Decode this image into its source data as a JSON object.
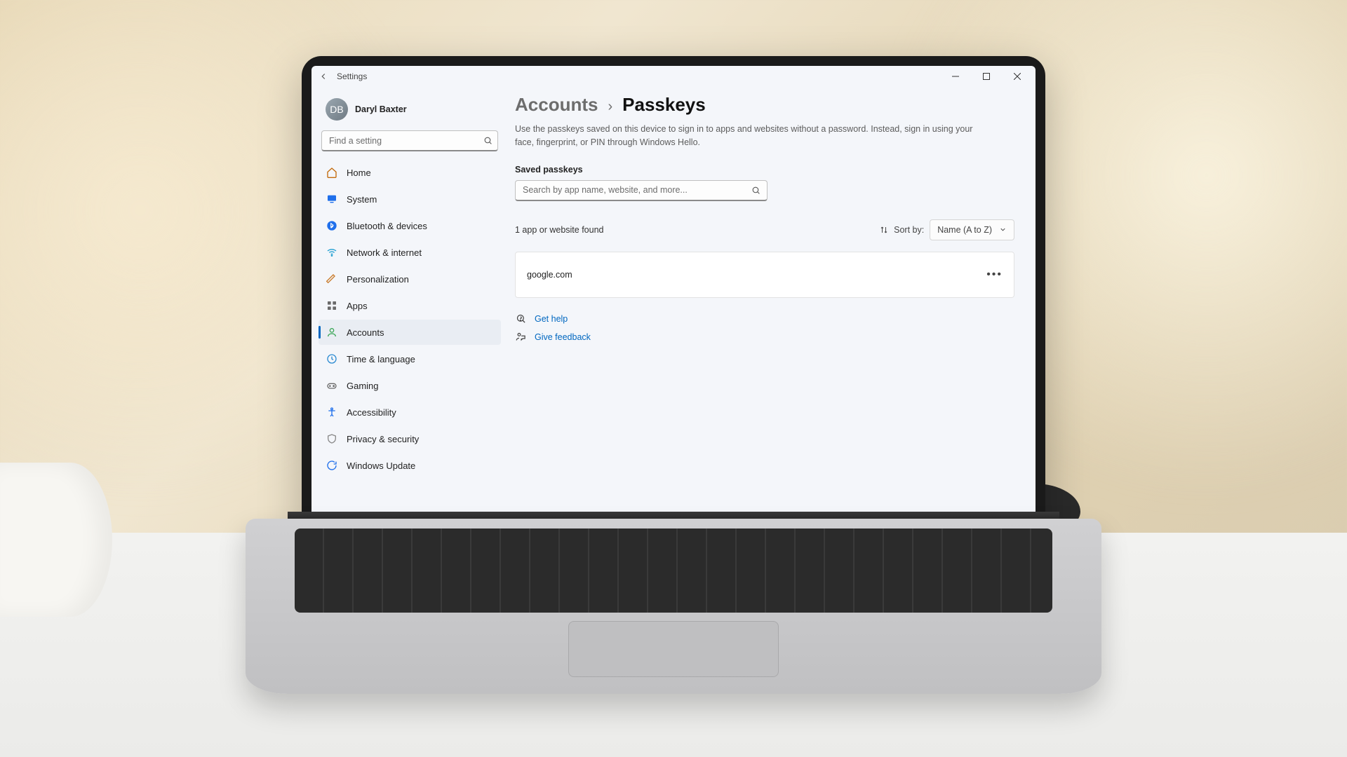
{
  "app_title": "Settings",
  "user": {
    "name": "Daryl Baxter",
    "initials": "DB"
  },
  "sidebar_search": {
    "placeholder": "Find a setting"
  },
  "nav": [
    {
      "key": "home",
      "label": "Home"
    },
    {
      "key": "system",
      "label": "System"
    },
    {
      "key": "bluetooth",
      "label": "Bluetooth & devices"
    },
    {
      "key": "network",
      "label": "Network & internet"
    },
    {
      "key": "personalization",
      "label": "Personalization"
    },
    {
      "key": "apps",
      "label": "Apps"
    },
    {
      "key": "accounts",
      "label": "Accounts"
    },
    {
      "key": "time",
      "label": "Time & language"
    },
    {
      "key": "gaming",
      "label": "Gaming"
    },
    {
      "key": "accessibility",
      "label": "Accessibility"
    },
    {
      "key": "privacy",
      "label": "Privacy & security"
    },
    {
      "key": "update",
      "label": "Windows Update"
    }
  ],
  "breadcrumb": {
    "parent": "Accounts",
    "separator": "›",
    "current": "Passkeys"
  },
  "blurb": "Use the passkeys saved on this device to sign in to apps and websites without a password. Instead, sign in using your face, fingerprint, or PIN through Windows Hello.",
  "saved_passkeys": {
    "heading": "Saved passkeys",
    "search_placeholder": "Search by app name, website, and more...",
    "found_text": "1 app or website found",
    "sort_label": "Sort by:",
    "sort_value": "Name (A to Z)",
    "entries": [
      {
        "site": "google.com"
      }
    ]
  },
  "help": {
    "get_help": "Get help",
    "give_feedback": "Give feedback"
  }
}
